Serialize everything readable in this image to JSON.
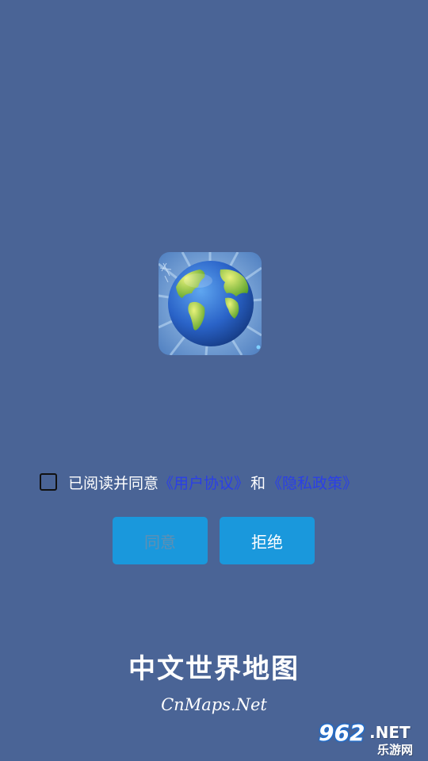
{
  "app": {
    "title": "中文世界地图",
    "subtitle": "CnMaps.Net"
  },
  "consent": {
    "prefix": "已阅读并同意",
    "user_agreement_link": "《用户协议》",
    "conjunction": "和",
    "privacy_policy_link": "《隐私政策》",
    "checked": false
  },
  "buttons": {
    "agree_label": "同意",
    "reject_label": "拒绝"
  },
  "logo": {
    "icon": "globe-icon"
  },
  "watermark": {
    "number": "962",
    "domain": ".NET",
    "site_name": "乐游网"
  },
  "colors": {
    "background": "#4a6496",
    "button": "#1a98dc",
    "link": "#2b3fe6"
  }
}
